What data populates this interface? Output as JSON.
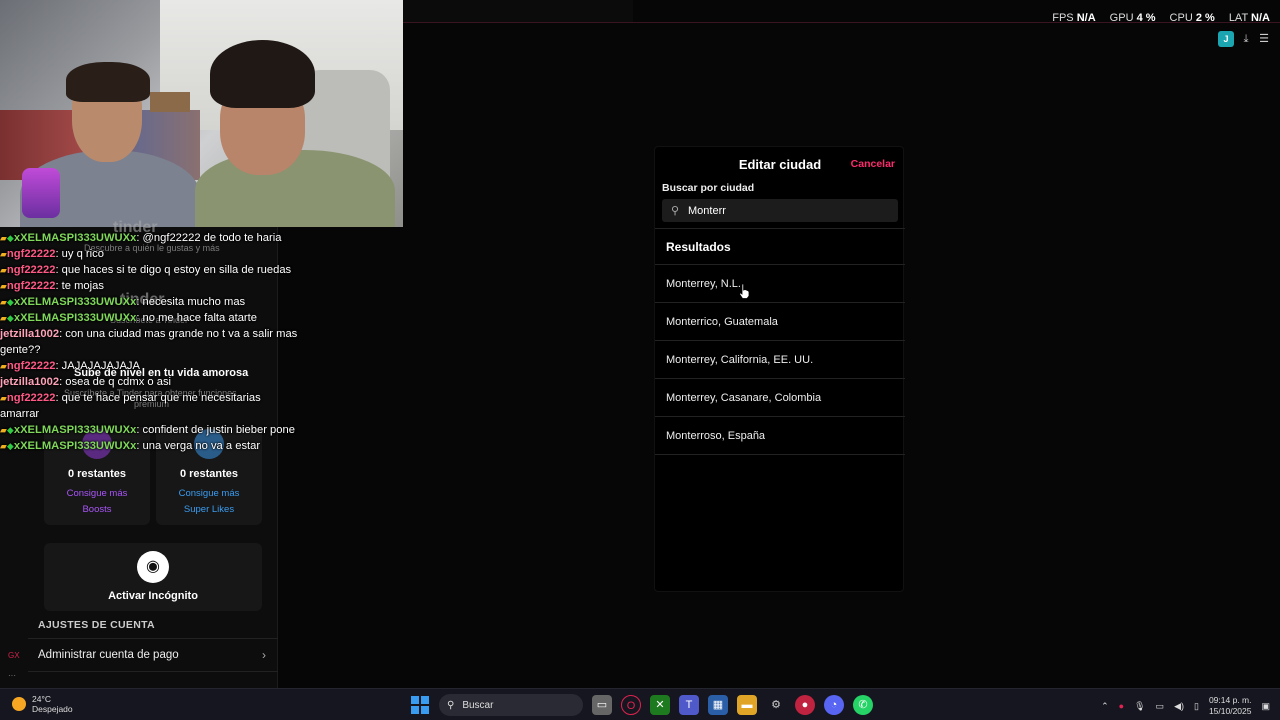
{
  "overlay": {
    "stats": [
      {
        "label": "FPS",
        "value": "N/A"
      },
      {
        "label": "GPU",
        "value": "4 %"
      },
      {
        "label": "CPU",
        "value": "2 %"
      },
      {
        "label": "LAT",
        "value": "N/A"
      }
    ],
    "j_badge": "J"
  },
  "chat": [
    {
      "badge": "crown-diamond",
      "user": "xXELMASPI333UWUXx",
      "color": "green",
      "text": ": @ngf22222 de todo te haria"
    },
    {
      "badge": "crown",
      "user": "ngf22222",
      "color": "pink",
      "text": ": uy q rico"
    },
    {
      "badge": "crown",
      "user": "ngf22222",
      "color": "pink",
      "text": ": que haces si te digo q estoy en silla de ruedas"
    },
    {
      "badge": "crown",
      "user": "ngf22222",
      "color": "pink",
      "text": ": te mojas"
    },
    {
      "badge": "crown-diamond",
      "user": "xXELMASPI333UWUXx",
      "color": "green",
      "text": ": necesita mucho mas"
    },
    {
      "badge": "crown-diamond",
      "user": "xXELMASPI333UWUXx",
      "color": "green",
      "text": ": no me hace falta atarte"
    },
    {
      "badge": "",
      "user": "jetzilla1002",
      "color": "rose",
      "text": ": con una ciudad mas grande no t va a salir mas gente??"
    },
    {
      "badge": "crown",
      "user": "ngf22222",
      "color": "pink",
      "text": ": JAJAJAJAJAJA"
    },
    {
      "badge": "",
      "user": "jetzilla1002",
      "color": "rose",
      "text": ": osea de q cdmx o asi"
    },
    {
      "badge": "crown",
      "user": "ngf22222",
      "color": "pink",
      "text": ": que te hace pensar que me necesitarias amarrar"
    },
    {
      "badge": "crown-diamond",
      "user": "xXELMASPI333UWUXx",
      "color": "green",
      "text": ": confident de justin bieber pone"
    },
    {
      "badge": "crown-diamond",
      "user": "xXELMASPI333UWUXx",
      "color": "green",
      "text": ": una verga no va a estar"
    }
  ],
  "left_panel": {
    "discover": "Descubre a quién le gustas y más",
    "tinder": "tinder",
    "subscribe": "Suscríbete a Tinder",
    "level_up": "Sube de nivel en tu vida amorosa",
    "premium_line": "Suscríbete a Tinder para obtener funciones",
    "premium": "premium",
    "boosts": {
      "count": "0 restantes",
      "line1": "Consigue más",
      "line2": "Boosts"
    },
    "superlikes": {
      "count": "0 restantes",
      "line1": "Consigue más",
      "line2": "Super Likes"
    },
    "incognito": "Activar Incógnito",
    "account_heading": "AJUSTES DE CUENTA",
    "payment": "Administrar cuenta de pago",
    "gx_label": "GX"
  },
  "modal": {
    "title": "Editar ciudad",
    "cancel": "Cancelar",
    "search_label": "Buscar por ciudad",
    "search_value": "Monterr",
    "results_heading": "Resultados",
    "results": [
      "Monterrey, N.L.",
      "Monterrico, Guatemala",
      "Monterrey, California, EE. UU.",
      "Monterrey, Casanare, Colombia",
      "Monterroso, España"
    ]
  },
  "taskbar": {
    "temp": "24°C",
    "weather": "Despejado",
    "search": "Buscar",
    "time": "09:14 p. m.",
    "date": "15/10/2025"
  },
  "colors": {
    "accent": "#fd2b6d",
    "boost": "#a855f7",
    "superlike": "#3b9cf0"
  }
}
